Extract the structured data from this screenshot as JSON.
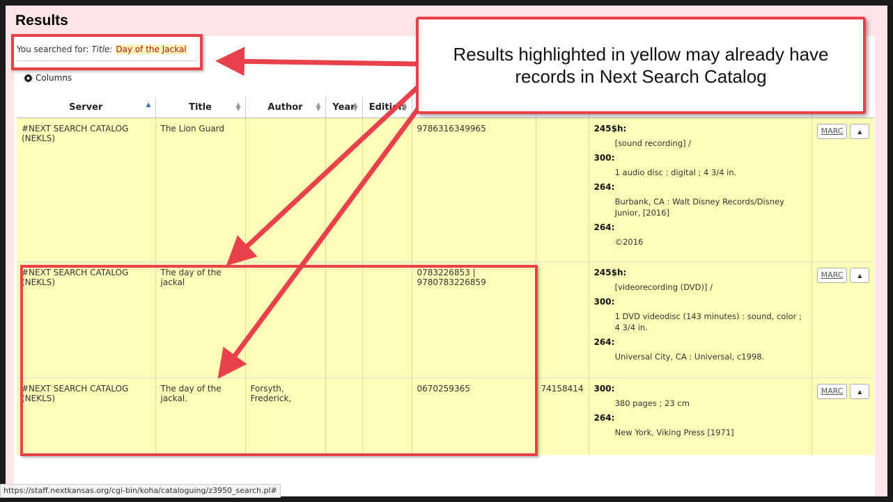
{
  "header": {
    "title": "Results"
  },
  "search": {
    "prefix": "You searched for:",
    "field": "Title:",
    "term": "Day of the Jackal"
  },
  "toolbar": {
    "columns_label": "Columns"
  },
  "table": {
    "columns": [
      "Server",
      "Title",
      "Author",
      "Year",
      "Edition",
      "",
      "",
      "",
      ""
    ],
    "rows": [
      {
        "server": "#NEXT SEARCH CATALOG (NEKLS)",
        "title": "The Lion Guard",
        "author": "",
        "year": "",
        "edition": "",
        "isbn": "9786316349965",
        "lccn": "",
        "marc": [
          {
            "tag": "245$h:",
            "value": "[sound recording] /"
          },
          {
            "tag": "300:",
            "value": "1 audio disc : digital ; 4 3/4 in."
          },
          {
            "tag": "264:",
            "value": "Burbank, CA : Walt Disney Records/Disney Junior, [2016]"
          },
          {
            "tag": "264:",
            "value": "©2016"
          }
        ],
        "marc_label": "MARC"
      },
      {
        "server": "#NEXT SEARCH CATALOG (NEKLS)",
        "title": "The day of the jackal",
        "author": "",
        "year": "",
        "edition": "",
        "isbn": "0783226853 | 9780783226859",
        "lccn": "",
        "marc": [
          {
            "tag": "245$h:",
            "value": "[videorecording (DVD)] /"
          },
          {
            "tag": "300:",
            "value": "1 DVD videodisc (143 minutes) : sound, color ; 4 3/4 in."
          },
          {
            "tag": "264:",
            "value": "Universal City, CA : Universal, c1998."
          }
        ],
        "marc_label": "MARC"
      },
      {
        "server": "#NEXT SEARCH CATALOG (NEKLS)",
        "title": "The day of the jackal.",
        "author": "Forsyth, Frederick,",
        "year": "",
        "edition": "",
        "isbn": "0670259365",
        "lccn": "74158414",
        "marc": [
          {
            "tag": "300:",
            "value": "380 pages ; 23 cm"
          },
          {
            "tag": "264:",
            "value": "New York, Viking Press [1971]"
          }
        ],
        "marc_label": "MARC"
      }
    ]
  },
  "callout": {
    "text": "Results highlighted in yellow may already have records in Next Search Catalog"
  },
  "statusbar": {
    "url": "https://staff.nextkansas.org/cgi-bin/koha/cataloguing/z3950_search.pl#"
  },
  "colors": {
    "highlight": "#fdfdb7",
    "annotation": "#e8414a"
  }
}
